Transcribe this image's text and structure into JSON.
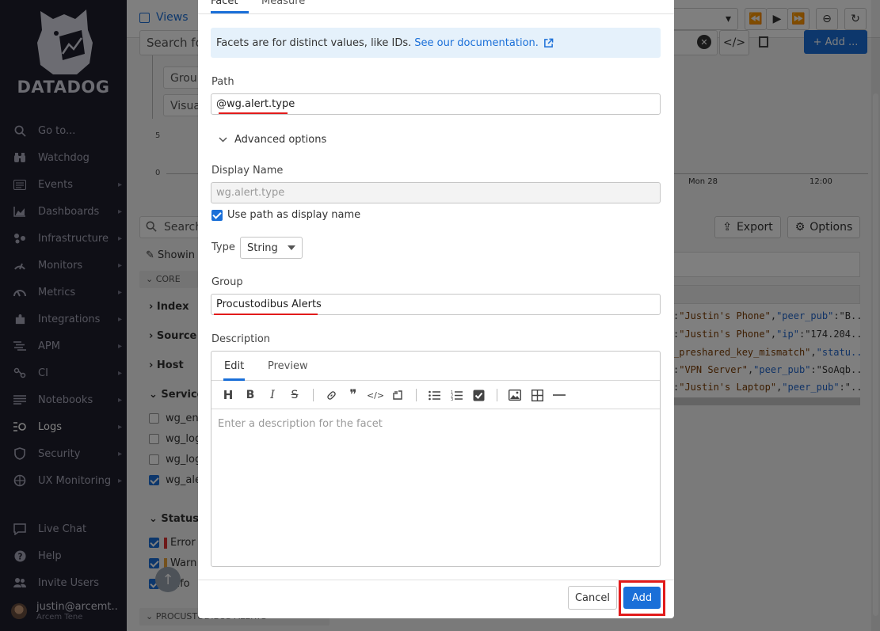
{
  "sidebar": {
    "brand": "DATADOG",
    "items": [
      {
        "label": "Go to...",
        "icon": "search-icon",
        "chevron": false
      },
      {
        "label": "Watchdog",
        "icon": "binoculars-icon",
        "chevron": false
      },
      {
        "label": "Events",
        "icon": "events-icon",
        "chevron": true
      },
      {
        "label": "Dashboards",
        "icon": "chart-icon",
        "chevron": true
      },
      {
        "label": "Infrastructure",
        "icon": "infrastructure-icon",
        "chevron": true
      },
      {
        "label": "Monitors",
        "icon": "monitors-icon",
        "chevron": true
      },
      {
        "label": "Metrics",
        "icon": "gauge-icon",
        "chevron": true
      },
      {
        "label": "Integrations",
        "icon": "puzzle-icon",
        "chevron": true
      },
      {
        "label": "APM",
        "icon": "apm-icon",
        "chevron": true
      },
      {
        "label": "CI",
        "icon": "ci-icon",
        "chevron": true
      },
      {
        "label": "Notebooks",
        "icon": "notebook-icon",
        "chevron": true
      },
      {
        "label": "Logs",
        "icon": "logs-icon",
        "chevron": true,
        "active": true
      },
      {
        "label": "Security",
        "icon": "shield-icon",
        "chevron": true
      },
      {
        "label": "UX Monitoring",
        "icon": "ux-icon",
        "chevron": true
      }
    ],
    "bottom_items": [
      {
        "label": "Live Chat",
        "icon": "chat-icon"
      },
      {
        "label": "Help",
        "icon": "help-icon"
      },
      {
        "label": "Invite Users",
        "icon": "users-icon"
      }
    ],
    "user": {
      "name": "justin@arcemt...",
      "org": "Arcem Tene"
    }
  },
  "background": {
    "views_label": "Views",
    "search_placeholder": "Search fo",
    "group_label": "Group",
    "visualize_label": "Visual",
    "chart_y_ticks": [
      "5",
      "0"
    ],
    "chart_x_ticks": [
      "Mon 28",
      "12:00"
    ],
    "add_button": "+ Add ...",
    "search2_placeholder": "Search",
    "export_label": "Export",
    "options_label": "Options",
    "showing_label": "Showin",
    "core_label": "CORE",
    "facets": [
      "Index",
      "Source",
      "Host",
      "Service"
    ],
    "service_values": [
      "wg_enc",
      "wg_log",
      "wg_log",
      "wg_ale"
    ],
    "status_label": "Status",
    "status_values": [
      "Error",
      "Warn",
      "Info"
    ],
    "bottom_group": "PROCUSTODIBUS ALERTS",
    "log_rows": [
      [
        ":",
        "\"Justin's Phone\"",
        ",",
        "\"peer_pub\"",
        ":\"B..."
      ],
      [
        ":",
        "\"Justin's Phone\"",
        ",",
        "\"ip\"",
        ":\"174.204..."
      ],
      [
        "_preshared_key_mismatch\"",
        "",
        ",",
        "\"statu...",
        ""
      ],
      [
        ":",
        "\"VPN Server\"",
        ",",
        "\"peer_pub\"",
        ":\"SoAqb..."
      ],
      [
        ":",
        "\"Justin's Laptop\"",
        ",",
        "\"peer_pub\"",
        ":\"..."
      ]
    ]
  },
  "modal": {
    "tabs": [
      "Facet",
      "Measure"
    ],
    "info_text": "Facets are for distinct values, like IDs.",
    "info_link": "See our documentation.",
    "path_label": "Path",
    "path_value": "@wg.alert.type",
    "advanced_label": "Advanced options",
    "display_name_label": "Display Name",
    "display_name_value": "wg.alert.type",
    "use_path_label": "Use path as display name",
    "type_label": "Type",
    "type_value": "String",
    "group_label": "Group",
    "group_value": "Procustodibus Alerts",
    "description_label": "Description",
    "desc_tabs": [
      "Edit",
      "Preview"
    ],
    "desc_placeholder": "Enter a description for the facet",
    "cancel_label": "Cancel",
    "add_label": "Add"
  },
  "colors": {
    "accent": "#1a6fd8",
    "highlight": "#e21b1b",
    "sidebar": "#1f1f2c"
  }
}
